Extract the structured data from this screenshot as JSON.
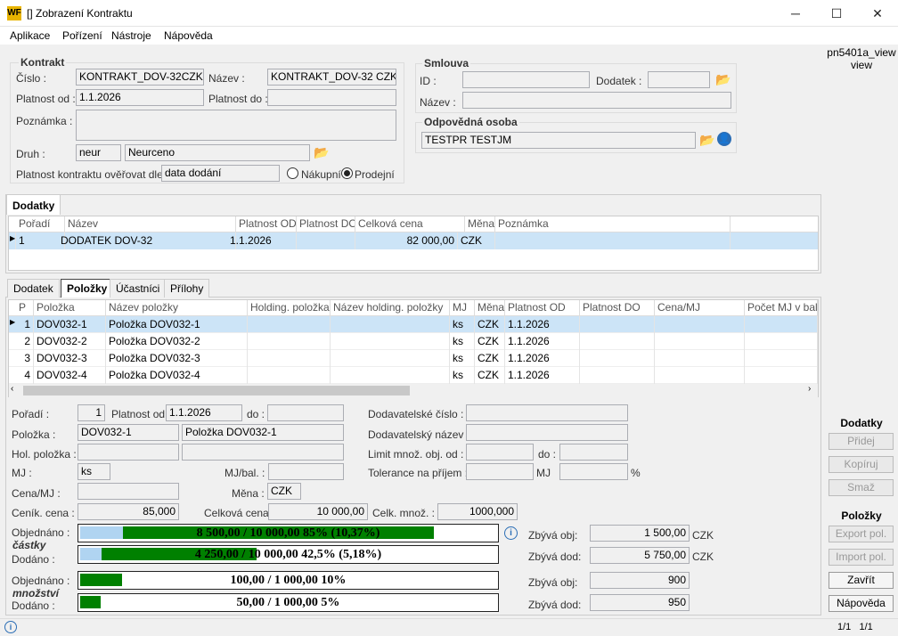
{
  "window": {
    "title": "[] Zobrazení Kontraktu",
    "minimize": "─",
    "maximize": "☐",
    "close": "✕"
  },
  "menu": [
    "Aplikace",
    "Pořízení",
    "Nástroje",
    "Nápověda"
  ],
  "kontrakt": {
    "group": "Kontrakt",
    "cislo_label": "Číslo :",
    "cislo": "KONTRAKT_DOV-32CZK",
    "nazev_label": "Název :",
    "nazev": "KONTRAKT_DOV-32 CZK",
    "platnost_od_label": "Platnost od :",
    "platnost_od": "1.1.2026",
    "platnost_do_label": "Platnost do :",
    "platnost_do": "",
    "poznamka_label": "Poznámka :",
    "poznamka": "",
    "druh_label": "Druh :",
    "druh_kod": "neur",
    "druh": "Neurceno",
    "overovat_label": "Platnost kontraktu ověřovat dle :",
    "overovat": "data dodání",
    "nakupni": "Nákupní",
    "prodejni": "Prodejní"
  },
  "smlouva": {
    "group": "Smlouva",
    "id_label": "ID :",
    "id": "",
    "dodatek_label": "Dodatek :",
    "dodatek": "",
    "nazev_label": "Název :",
    "nazev": ""
  },
  "osoba": {
    "group": "Odpovědná osoba",
    "value": "TESTPR TESTJM"
  },
  "dodatky": {
    "tab": "Dodatky",
    "columns": [
      "Pořadí",
      "Název",
      "Platnost OD",
      "Platnost DO",
      "Celková cena",
      "Měna",
      "Poznámka"
    ],
    "rows": [
      {
        "poradi": "1",
        "nazev": "DODATEK DOV-32",
        "od": "1.1.2026",
        "do": "",
        "cena": "82 000,00",
        "mena": "CZK",
        "pozn": ""
      }
    ]
  },
  "tabs": [
    "Dodatek",
    "Položky",
    "Účastníci",
    "Přílohy"
  ],
  "polozky": {
    "columns": [
      "P",
      "Položka",
      "Název položky",
      "Holding. položka",
      "Název holding. položky",
      "MJ",
      "Měna",
      "Platnost OD",
      "Platnost DO",
      "Cena/MJ",
      "Počet MJ v bal."
    ],
    "rows": [
      {
        "p": "1",
        "pol": "DOV032-1",
        "nazev": "Položka DOV032-1",
        "mj": "ks",
        "mena": "CZK",
        "od": "1.1.2026"
      },
      {
        "p": "2",
        "pol": "DOV032-2",
        "nazev": "Položka DOV032-2",
        "mj": "ks",
        "mena": "CZK",
        "od": "1.1.2026"
      },
      {
        "p": "3",
        "pol": "DOV032-3",
        "nazev": "Položka DOV032-3",
        "mj": "ks",
        "mena": "CZK",
        "od": "1.1.2026"
      },
      {
        "p": "4",
        "pol": "DOV032-4",
        "nazev": "Položka DOV032-4",
        "mj": "ks",
        "mena": "CZK",
        "od": "1.1.2026"
      }
    ]
  },
  "detail": {
    "poradi_label": "Pořadí :",
    "poradi": "1",
    "platnost_od_label": "Platnost od :",
    "platnost_od": "1.1.2026",
    "do_label": "do :",
    "do": "",
    "polozka_label": "Položka :",
    "polozka": "DOV032-1",
    "polozka_nazev": "Položka DOV032-1",
    "hol_label": "Hol. položka :",
    "mj_label": "MJ :",
    "mj": "ks",
    "mjbal_label": "MJ/bal. :",
    "cenamj_label": "Cena/MJ :",
    "mena_label": "Měna :",
    "mena": "CZK",
    "cenik_label": "Ceník. cena :",
    "cenik": "85,000",
    "celkova_label": "Celková cena:",
    "celkova": "10 000,00",
    "celkmnoz_label": "Celk. množ. :",
    "celkmnoz": "1000,000",
    "dod_cislo_label": "Dodavatelské číslo :",
    "dod_nazev_label": "Dodavatelský název :",
    "limit_label": "Limit množ. obj. od :",
    "limit_do_label": "do :",
    "tolerance_label": "Tolerance na příjem :",
    "tol_mj_label": "MJ",
    "tol_pct": "%"
  },
  "progress": {
    "objednano_label": "Objednáno :",
    "castky_label": "částky",
    "dodano_label": "Dodáno :",
    "mnozstvi_label": "množství",
    "c_obj_text": "8 500,00 / 10 000,00     85%  (10,37%)",
    "c_obj_pct": 85,
    "c_obj_pre": 10.37,
    "c_dod_text": "4 250,00 / 10 000,00     42,5%  (5,18%)",
    "c_dod_pct": 42.5,
    "c_dod_pre": 5.18,
    "m_obj_text": "100,00 / 1 000,00      10%",
    "m_obj_pct": 10,
    "m_dod_text": "50,00 / 1 000,00      5%",
    "m_dod_pct": 5,
    "zbyva_obj_label": "Zbývá obj:",
    "zbyva_dod_label": "Zbývá dod:",
    "c_zbyva_obj": "1 500,00",
    "c_zbyva_dod": "5 750,00",
    "mena": "CZK",
    "m_zbyva_obj": "900",
    "m_zbyva_dod": "950",
    "fill_color": "#008000",
    "pre_color": "#b0d4f1"
  },
  "side": {
    "view_name": "pn5401a_view",
    "view_sub": "view",
    "dodatky": "Dodatky",
    "pridej": "Přidej",
    "kopiruj": "Kopíruj",
    "smaz": "Smaž",
    "polozky": "Položky",
    "export": "Export pol.",
    "import": "Import pol.",
    "zavrit": "Zavřít",
    "napoveda": "Nápověda"
  },
  "status": {
    "page": "1/1   1/1"
  }
}
